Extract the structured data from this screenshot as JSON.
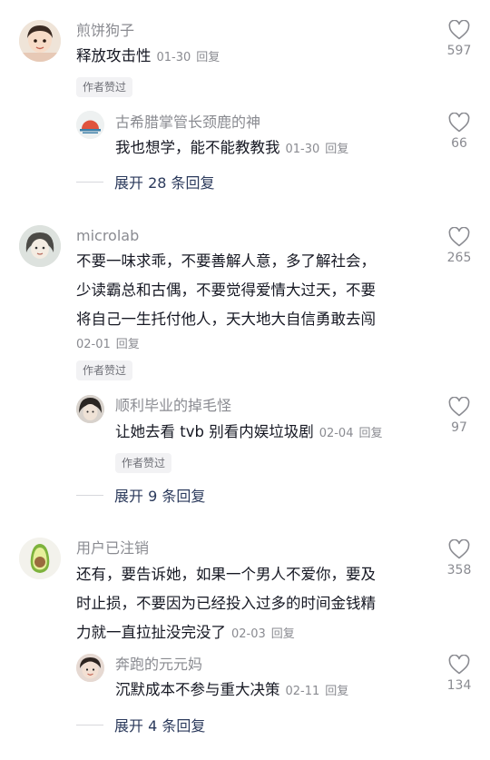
{
  "ui": {
    "author_liked": "作者赞过",
    "reply": "回复"
  },
  "comments": [
    {
      "user": "煎饼狗子",
      "text": "释放攻击性",
      "date": "01-30",
      "likes": "597",
      "reply": {
        "user": "古希腊掌管长颈鹿的神",
        "text": "我也想学，能不能教教我",
        "date": "01-30",
        "likes": "66"
      },
      "expand": "展开 28 条回复"
    },
    {
      "user": "microlab",
      "text_lines": [
        "不要一味求乖，不要善解人意，多了解社会，",
        "少读霸总和古偶，不要觉得爱情大过天，不要",
        "将自己一生托付他人，天大地大自信勇敢去闯"
      ],
      "date": "02-01",
      "likes": "265",
      "reply": {
        "user": "顺利毕业的掉毛怪",
        "text": "让她去看 tvb 别看内娱垃圾剧",
        "date": "02-04",
        "likes": "97"
      },
      "expand": "展开 9 条回复"
    },
    {
      "user": "用户已注销",
      "text_lines": [
        "还有，要告诉她，如果一个男人不爱你，要及",
        "时止损，不要因为已经投入过多的时间金钱精",
        "力就一直拉扯没完没了"
      ],
      "date": "02-03",
      "likes": "358",
      "reply": {
        "user": "奔跑的元元妈",
        "text": "沉默成本不参与重大决策",
        "date": "02-11",
        "likes": "134"
      },
      "expand": "展开 4 条回复"
    }
  ]
}
